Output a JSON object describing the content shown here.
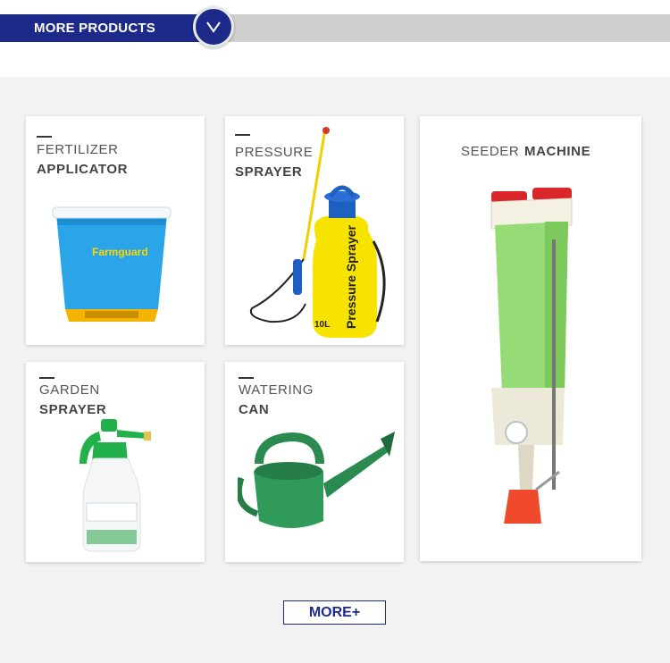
{
  "header": {
    "title": "MORE PRODUCTS",
    "toggle_glyph": "V"
  },
  "products": [
    {
      "line1": "FERTILIZER",
      "line2": "APPLICATOR",
      "brand": "Farmguard"
    },
    {
      "line1": "PRESSURE",
      "line2": "SPRAYER",
      "label_text": "Pressure Sprayer",
      "capacity": "10L"
    },
    {
      "line1": "SEEDER",
      "line2": "MACHINE"
    },
    {
      "line1": "GARDEN",
      "line2": "SPRAYER"
    },
    {
      "line1": "WATERING",
      "line2": "CAN"
    }
  ],
  "more_button": {
    "label": "MORE+"
  },
  "colors": {
    "brand_blue": "#1d2a8a",
    "header_gray": "#cfcfcf",
    "panel_bg": "#f2f2f2"
  }
}
